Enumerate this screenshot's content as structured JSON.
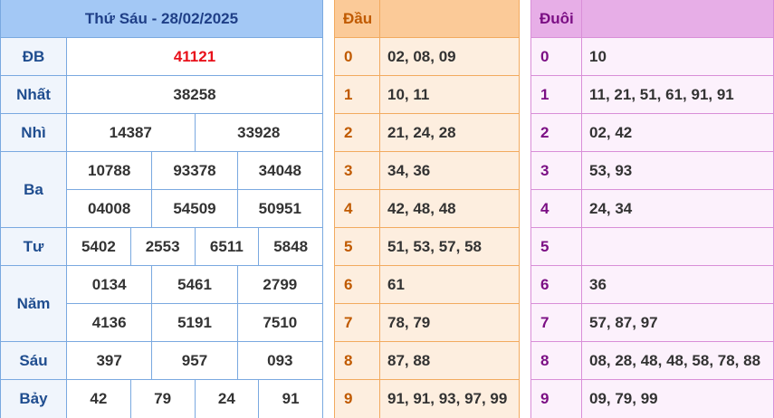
{
  "results": {
    "title": "Thứ Sáu - 28/02/2025",
    "prizes": [
      {
        "label": "ĐB",
        "lines": [
          [
            "41121"
          ]
        ]
      },
      {
        "label": "Nhất",
        "lines": [
          [
            "38258"
          ]
        ]
      },
      {
        "label": "Nhì",
        "lines": [
          [
            "14387",
            "33928"
          ]
        ]
      },
      {
        "label": "Ba",
        "lines": [
          [
            "10788",
            "93378",
            "34048"
          ],
          [
            "04008",
            "54509",
            "50951"
          ]
        ]
      },
      {
        "label": "Tư",
        "lines": [
          [
            "5402",
            "2553",
            "6511",
            "5848"
          ]
        ]
      },
      {
        "label": "Năm",
        "lines": [
          [
            "0134",
            "5461",
            "2799"
          ],
          [
            "4136",
            "5191",
            "7510"
          ]
        ]
      },
      {
        "label": "Sáu",
        "lines": [
          [
            "397",
            "957",
            "093"
          ]
        ]
      },
      {
        "label": "Bảy",
        "lines": [
          [
            "42",
            "79",
            "24",
            "91"
          ]
        ]
      }
    ]
  },
  "dau": {
    "header": "Đầu",
    "rows": [
      {
        "key": "0",
        "value": "02, 08, 09"
      },
      {
        "key": "1",
        "value": "10, 11"
      },
      {
        "key": "2",
        "value": "21, 24, 28"
      },
      {
        "key": "3",
        "value": "34, 36"
      },
      {
        "key": "4",
        "value": "42, 48, 48"
      },
      {
        "key": "5",
        "value": "51, 53, 57, 58"
      },
      {
        "key": "6",
        "value": "61"
      },
      {
        "key": "7",
        "value": "78, 79"
      },
      {
        "key": "8",
        "value": "87, 88"
      },
      {
        "key": "9",
        "value": "91, 91, 93, 97, 99"
      }
    ]
  },
  "duoi": {
    "header": "Đuôi",
    "rows": [
      {
        "key": "0",
        "value": "10"
      },
      {
        "key": "1",
        "value": "11, 21, 51, 61, 91, 91"
      },
      {
        "key": "2",
        "value": "02, 42"
      },
      {
        "key": "3",
        "value": "53, 93"
      },
      {
        "key": "4",
        "value": "24, 34"
      },
      {
        "key": "5",
        "value": ""
      },
      {
        "key": "6",
        "value": "36"
      },
      {
        "key": "7",
        "value": "57, 87, 97"
      },
      {
        "key": "8",
        "value": "08, 28, 48, 48, 58, 78, 88"
      },
      {
        "key": "9",
        "value": "09, 79, 99"
      }
    ]
  },
  "colors": {
    "special_prize": "#e8101a",
    "results_header_bg": "#a3c8f5",
    "dau_header_bg": "#fbca98",
    "duoi_header_bg": "#e7aee7"
  }
}
